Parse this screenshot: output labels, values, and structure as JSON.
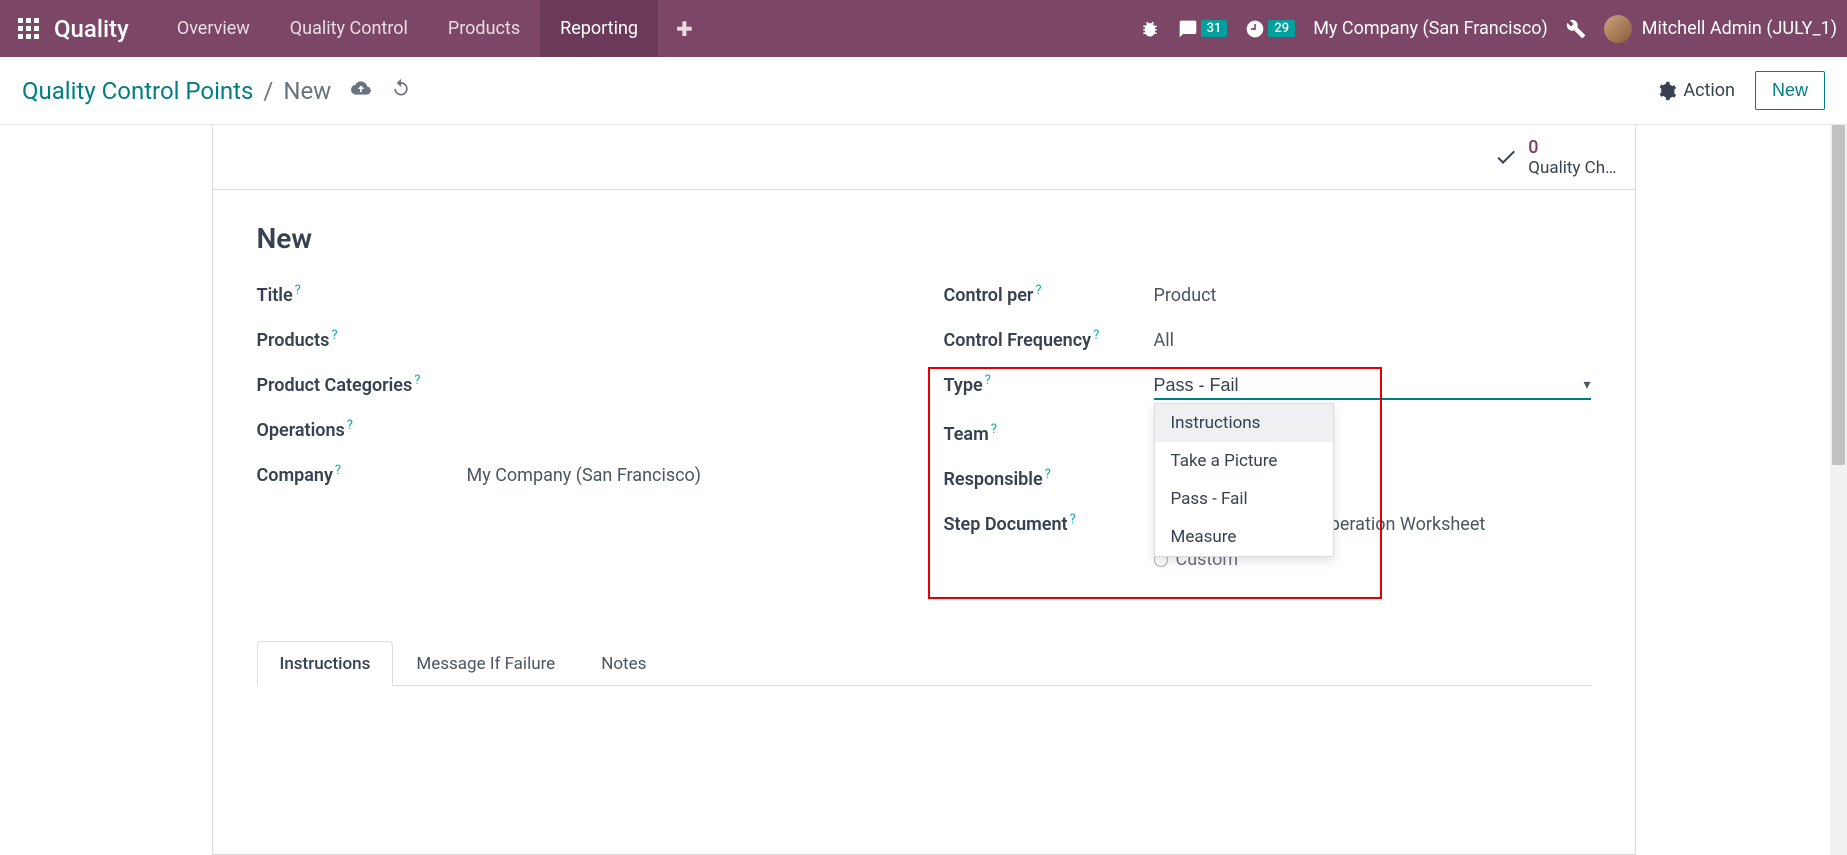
{
  "topnav": {
    "brand": "Quality",
    "items": [
      "Overview",
      "Quality Control",
      "Products",
      "Reporting"
    ],
    "active_index": 3,
    "messages_badge": "31",
    "activity_badge": "29",
    "company": "My Company (San Francisco)",
    "user": "Mitchell Admin (JULY_1)"
  },
  "controlbar": {
    "breadcrumb_parent": "Quality Control Points",
    "breadcrumb_current": "New",
    "action_label": "Action",
    "new_label": "New"
  },
  "status": {
    "count": "0",
    "label": "Quality Ch…"
  },
  "form": {
    "heading": "New",
    "left": {
      "title_label": "Title",
      "products_label": "Products",
      "categories_label": "Product Categories",
      "operations_label": "Operations",
      "company_label": "Company",
      "company_value": "My Company (San Francisco)"
    },
    "right": {
      "control_per_label": "Control per",
      "control_per_value": "Product",
      "control_freq_label": "Control Frequency",
      "control_freq_value": "All",
      "type_label": "Type",
      "type_value": "Pass - Fail",
      "team_label": "Team",
      "responsible_label": "Responsible",
      "step_doc_label": "Step Document",
      "step_doc_option_visible": ")peration Worksheet",
      "step_doc_custom": "Custom"
    },
    "type_dropdown": {
      "options": [
        "Instructions",
        "Take a Picture",
        "Pass - Fail",
        "Measure"
      ],
      "highlighted_index": 0
    }
  },
  "tabs": {
    "items": [
      "Instructions",
      "Message If Failure",
      "Notes"
    ],
    "active_index": 0
  }
}
